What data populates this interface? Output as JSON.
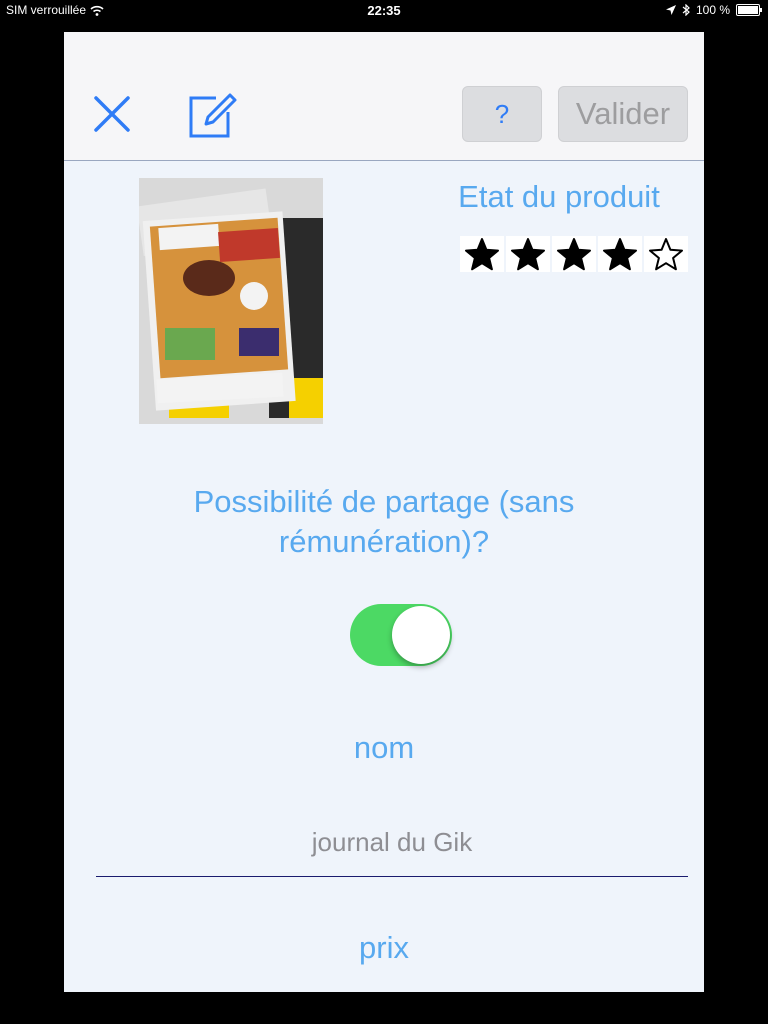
{
  "status_bar": {
    "carrier": "SIM verrouillée",
    "time": "22:35",
    "battery": "100 %",
    "battery_level": 1.0
  },
  "toolbar": {
    "close_icon": "close-icon",
    "edit_icon": "edit-icon",
    "help_label": "?",
    "validate_label": "Valider"
  },
  "product": {
    "image_icon": "product-photo",
    "condition_label": "Etat du produit",
    "rating": 4,
    "rating_max": 5
  },
  "share": {
    "question": "Possibilité de partage (sans rémunération)?",
    "enabled": true
  },
  "form": {
    "name_label": "nom",
    "name_value": "journal du Gik",
    "price_label": "prix"
  },
  "colors": {
    "accent": "#58a9ef",
    "toggle_on": "#4cd964",
    "icon_blue": "#2f7cf6"
  }
}
